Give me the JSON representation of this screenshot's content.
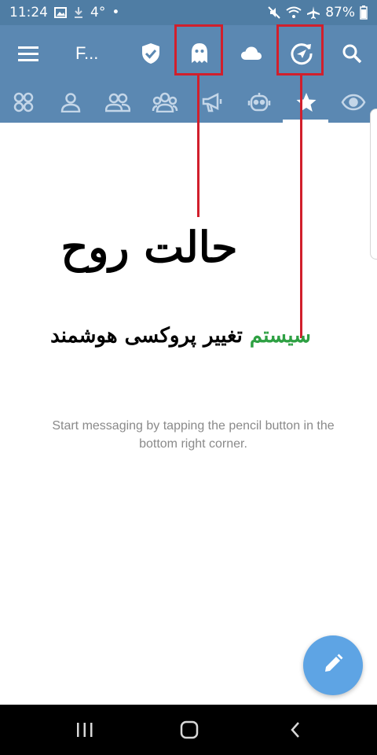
{
  "status_bar": {
    "time": "11:24",
    "notif_count": "4°",
    "battery": "87%",
    "icons": [
      "image-icon",
      "download-icon",
      "dot-icon",
      "mute-icon",
      "wifi-icon",
      "airplane-icon",
      "battery-icon"
    ]
  },
  "toolbar": {
    "title": "F...",
    "icons": [
      "menu-icon",
      "shield-check-icon",
      "ghost-icon",
      "cloud-icon",
      "proxy-refresh-icon",
      "search-icon"
    ]
  },
  "tabs": {
    "items": [
      "all-chats-icon",
      "user-icon",
      "contacts-icon",
      "groups-icon",
      "channel-icon",
      "bot-icon",
      "favorites-icon",
      "unread-icon"
    ],
    "active_index": 6
  },
  "annotations": {
    "ghost_label": "حالت روح",
    "proxy_label_prefix": "سیستم",
    "proxy_label_suffix": " تغییر پروکسی هوشمند",
    "color": "#d11f2c",
    "green": "#2ea043"
  },
  "empty_state": {
    "message": "Start messaging by tapping the pencil button in the bottom right corner."
  },
  "fab": {
    "icon": "pencil-icon"
  },
  "nav_bar": {
    "icons": [
      "recent-apps-icon",
      "home-icon",
      "back-icon"
    ]
  },
  "colors": {
    "header": "#5b88b2",
    "status": "#4f7da4",
    "fab": "#5ea4e4"
  }
}
